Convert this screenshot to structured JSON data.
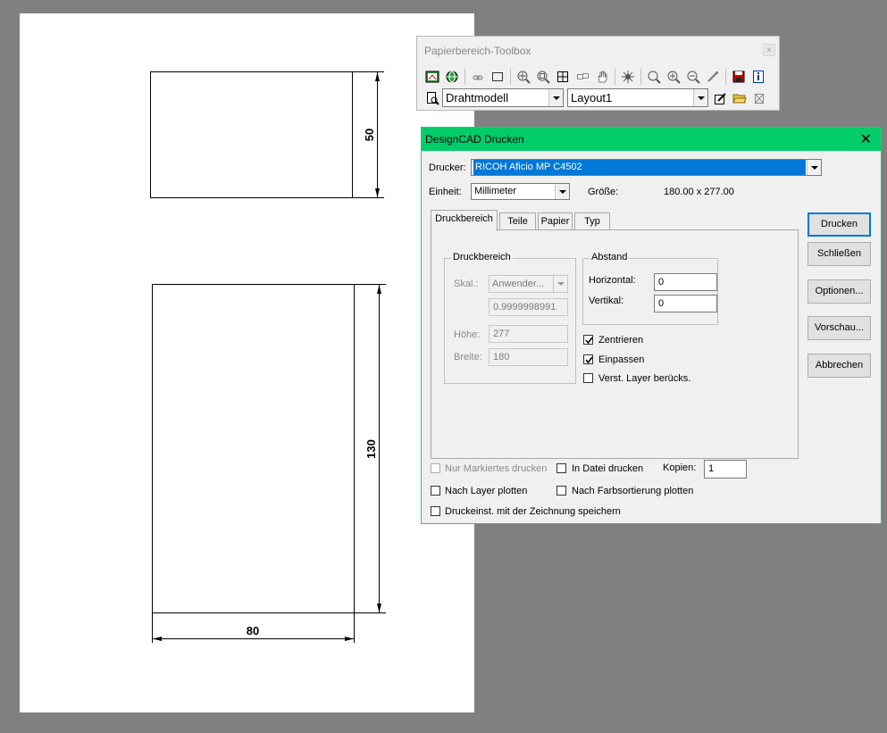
{
  "drawing": {
    "dim_top_height": "50",
    "dim_bottom_height": "130",
    "dim_bottom_width": "80"
  },
  "toolbox": {
    "title": "Papierbereich-Toolbox",
    "close_glyph": "×",
    "view_mode": "Drahtmodell",
    "layout": "Layout1"
  },
  "dialog": {
    "title": "DesignCAD Drucken",
    "close_glyph": "✕",
    "printer_label": "Drucker:",
    "printer_value": "RICOH Aficio MP C4502",
    "unit_label": "Einheit:",
    "unit_value": "Millimeter",
    "size_label": "Größe:",
    "size_value": "180.00 x 277.00",
    "tabs": [
      "Druckbereich",
      "Teile",
      "Papier",
      "Typ"
    ],
    "druckbereich": {
      "group_title": "Druckbereich",
      "scale_label": "Skal.:",
      "scale_value": "Anwender...",
      "scale_factor": "0.9999998991",
      "height_label": "Höhe:",
      "height_value": "277",
      "width_label": "Breite:",
      "width_value": "180"
    },
    "abstand": {
      "group_title": "Abstand",
      "horizontal_label": "Horizontal:",
      "horizontal_value": "0",
      "vertical_label": "Vertikal:",
      "vertical_value": "0"
    },
    "options": {
      "center_label": "Zentrieren",
      "center_checked": true,
      "fit_label": "Einpassen",
      "fit_checked": true,
      "hidden_layer_label": "Verst. Layer berücks.",
      "hidden_layer_checked": false
    },
    "bottom": {
      "marked_only_label": "Nur Markiertes drucken",
      "to_file_label": "In Datei drucken",
      "copies_label": "Kopien:",
      "copies_value": "1",
      "by_layer_label": "Nach Layer plotten",
      "by_color_label": "Nach Farbsortierung plotten",
      "save_settings_label": "Druckeinst. mit der Zeichnung speichern"
    },
    "buttons": {
      "print": "Drucken",
      "close": "Schließen",
      "options": "Optionen...",
      "preview": "Vorschau...",
      "cancel": "Abbrechen"
    }
  }
}
